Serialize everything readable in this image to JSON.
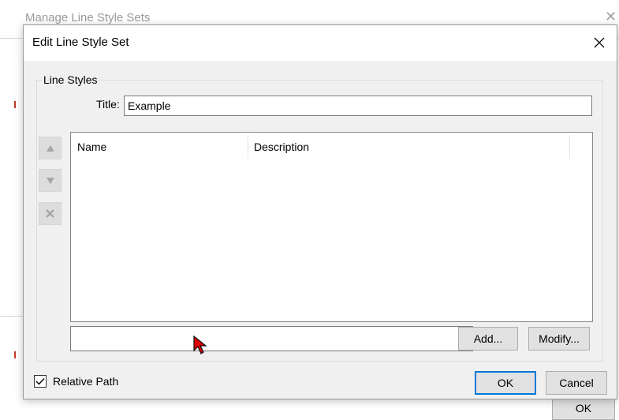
{
  "background_window": {
    "title": "Manage Line Style Sets",
    "ok_label": "OK"
  },
  "dialog": {
    "title": "Edit Line Style Set",
    "group_label": "Line Styles",
    "title_field_label": "Title:",
    "title_value": "Example",
    "list": {
      "columns": [
        "Name",
        "Description"
      ],
      "rows": []
    },
    "bottom_input_value": "",
    "add_label": "Add...",
    "modify_label": "Modify...",
    "relative_path_label": "Relative Path",
    "relative_path_checked": true,
    "ok_label": "OK",
    "cancel_label": "Cancel"
  },
  "icons": {
    "move_up": "triangle-up-icon",
    "move_down": "triangle-down-icon",
    "delete": "x-icon",
    "close": "close-icon",
    "checkmark": "checkmark-icon",
    "cursor": "mouse-cursor-icon"
  },
  "colors": {
    "dialog_bg": "#f0f0f0",
    "default_button_border": "#0078d7",
    "cursor": "#e00000"
  }
}
